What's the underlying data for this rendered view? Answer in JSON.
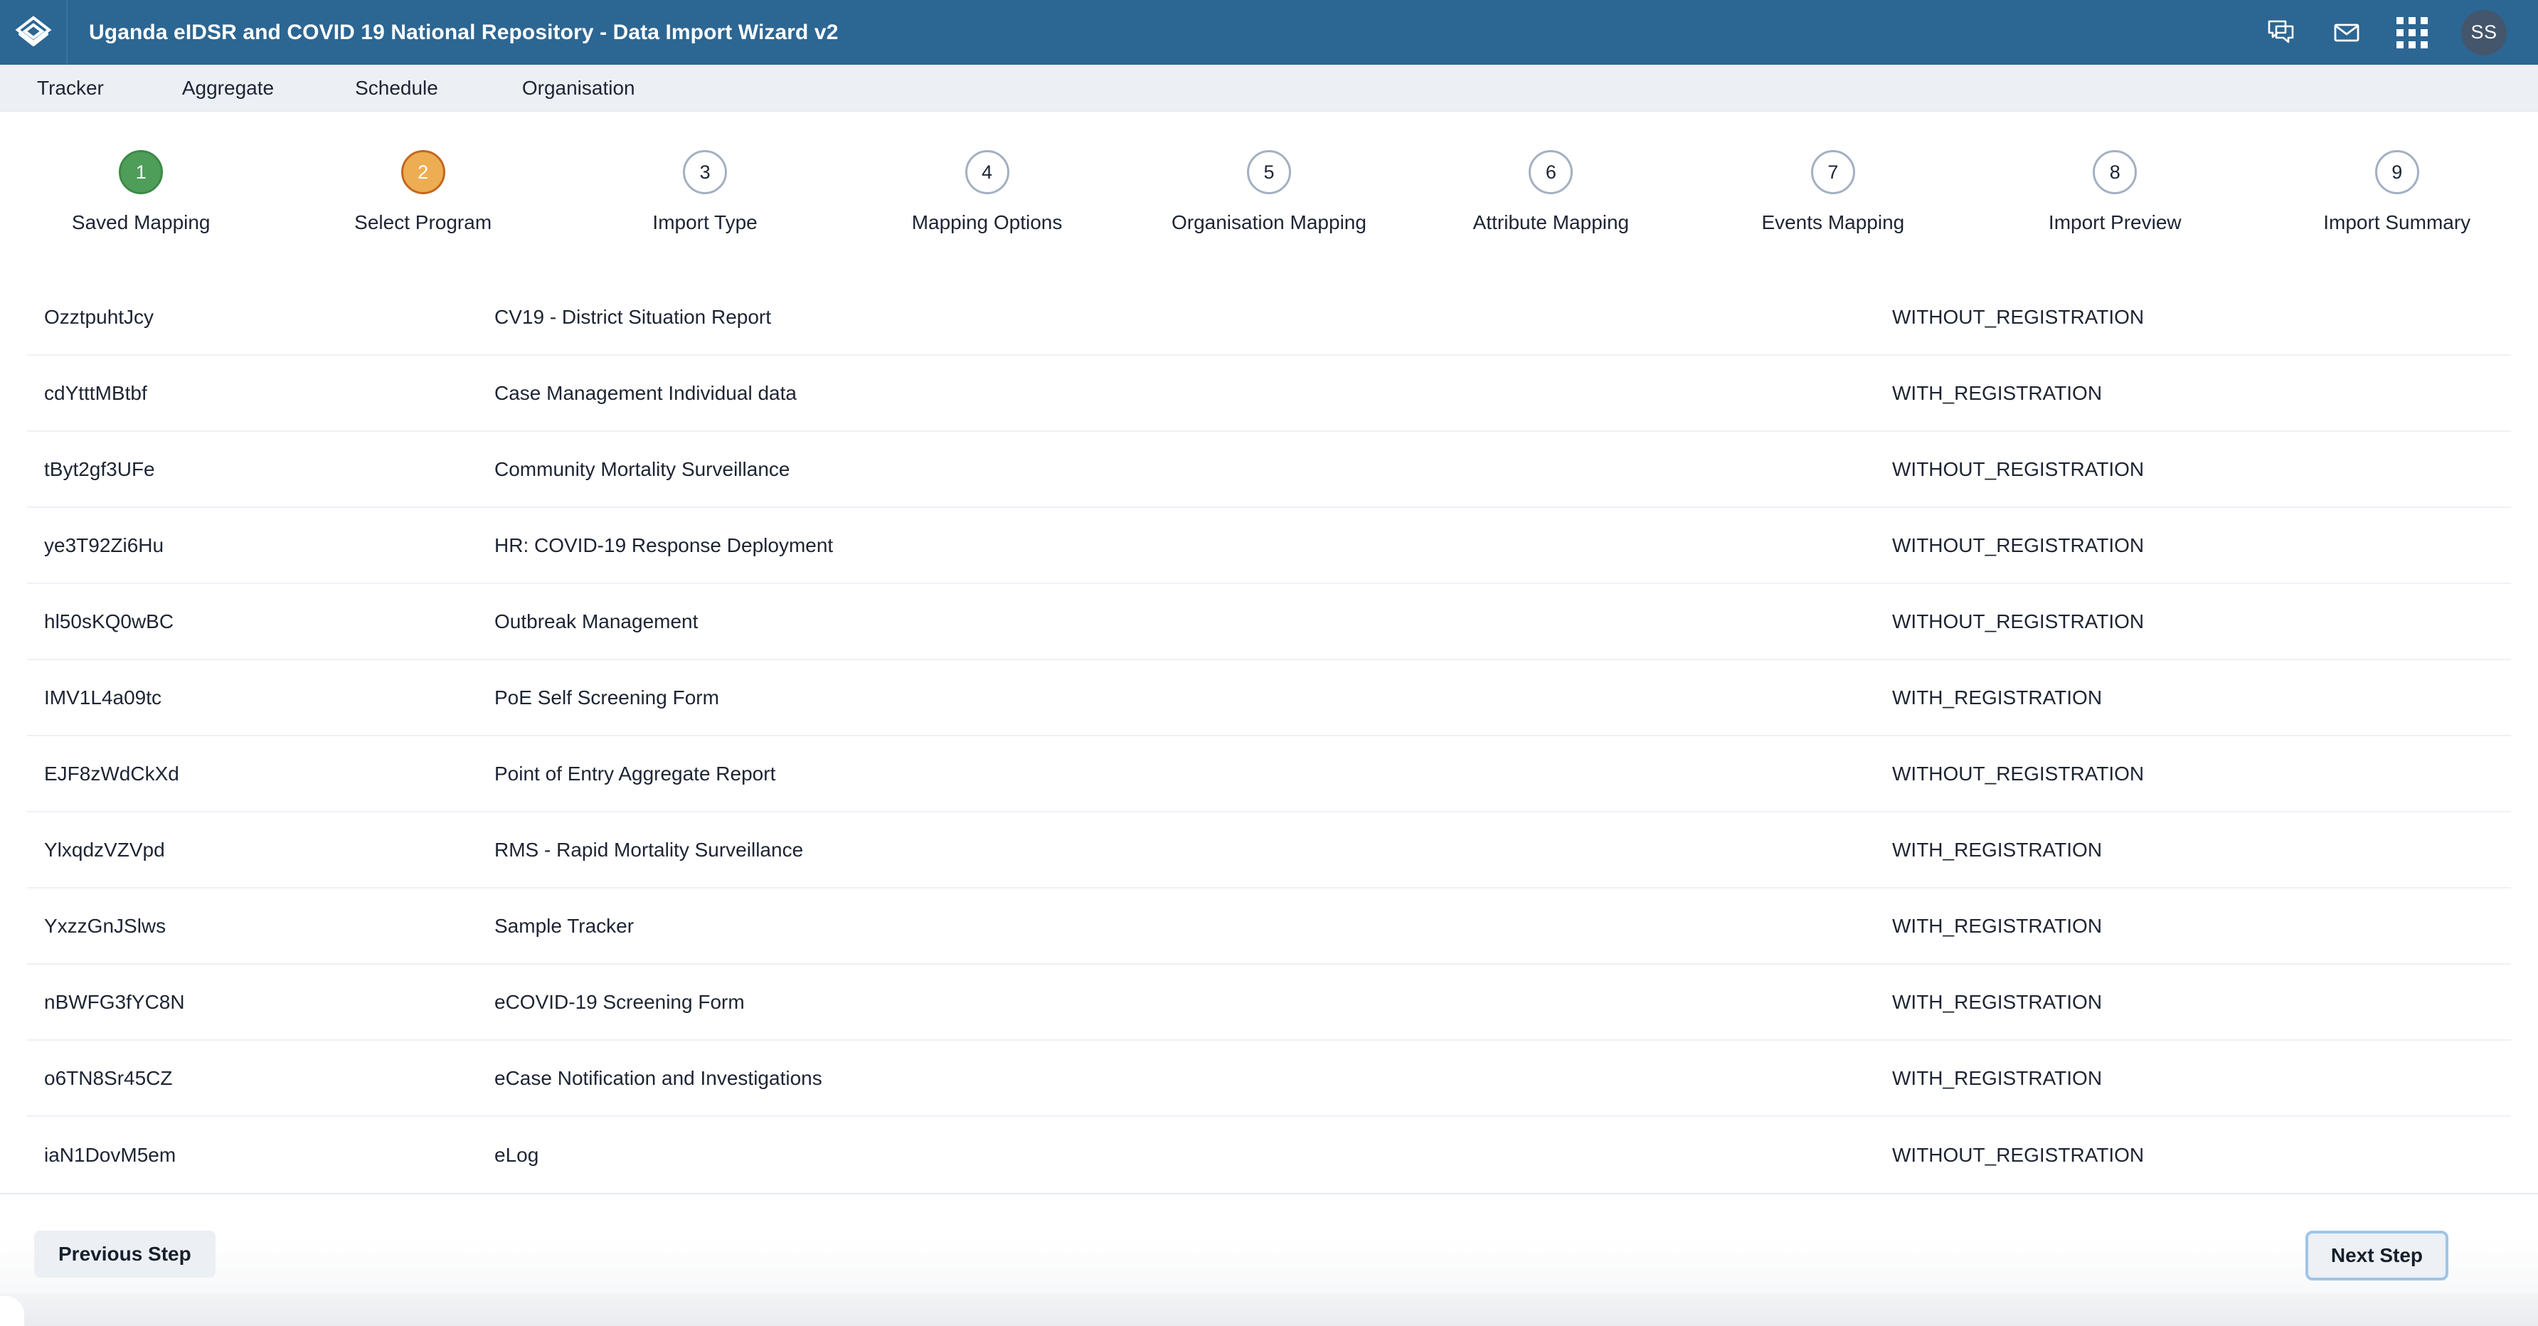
{
  "header": {
    "logo_icon": "layers-diamond-icon",
    "title": "Uganda eIDSR and COVID 19 National Repository - Data Import Wizard v2",
    "actions": [
      {
        "icon": "chat-bubbles-icon",
        "name": "messages-conversations"
      },
      {
        "icon": "envelope-icon",
        "name": "email"
      },
      {
        "icon": "apps-grid-icon",
        "name": "apps-menu"
      }
    ],
    "avatar_initials": "SS"
  },
  "nav": {
    "tabs": [
      {
        "label": "Tracker"
      },
      {
        "label": "Aggregate"
      },
      {
        "label": "Schedule"
      },
      {
        "label": "Organisation"
      }
    ]
  },
  "stepper": {
    "steps": [
      {
        "number": "1",
        "label": "Saved Mapping",
        "state": "done"
      },
      {
        "number": "2",
        "label": "Select Program",
        "state": "active"
      },
      {
        "number": "3",
        "label": "Import Type",
        "state": "pending"
      },
      {
        "number": "4",
        "label": "Mapping Options",
        "state": "pending"
      },
      {
        "number": "5",
        "label": "Organisation Mapping",
        "state": "pending"
      },
      {
        "number": "6",
        "label": "Attribute Mapping",
        "state": "pending"
      },
      {
        "number": "7",
        "label": "Events Mapping",
        "state": "pending"
      },
      {
        "number": "8",
        "label": "Import Preview",
        "state": "pending"
      },
      {
        "number": "9",
        "label": "Import Summary",
        "state": "pending"
      }
    ],
    "colors": {
      "done": "#4e9e5a",
      "active": "#edad53",
      "pending_border": "#a3b0c2"
    }
  },
  "table": {
    "rows": [
      {
        "id": "OzztpuhtJcy",
        "name": "CV19 - District Situation Report",
        "type": "WITHOUT_REGISTRATION"
      },
      {
        "id": "cdYtttMBtbf",
        "name": "Case Management Individual data",
        "type": "WITH_REGISTRATION"
      },
      {
        "id": "tByt2gf3UFe",
        "name": "Community Mortality Surveillance",
        "type": "WITHOUT_REGISTRATION"
      },
      {
        "id": "ye3T92Zi6Hu",
        "name": "HR: COVID-19 Response Deployment",
        "type": "WITHOUT_REGISTRATION"
      },
      {
        "id": "hl50sKQ0wBC",
        "name": "Outbreak Management",
        "type": "WITHOUT_REGISTRATION"
      },
      {
        "id": "IMV1L4a09tc",
        "name": "PoE Self Screening Form",
        "type": "WITH_REGISTRATION"
      },
      {
        "id": "EJF8zWdCkXd",
        "name": "Point of Entry Aggregate Report",
        "type": "WITHOUT_REGISTRATION"
      },
      {
        "id": "YlxqdzVZVpd",
        "name": "RMS - Rapid Mortality Surveillance",
        "type": "WITH_REGISTRATION"
      },
      {
        "id": "YxzzGnJSlws",
        "name": "Sample Tracker",
        "type": "WITH_REGISTRATION"
      },
      {
        "id": "nBWFG3fYC8N",
        "name": "eCOVID-19 Screening Form",
        "type": "WITH_REGISTRATION"
      },
      {
        "id": "o6TN8Sr45CZ",
        "name": "eCase Notification and Investigations",
        "type": "WITH_REGISTRATION"
      },
      {
        "id": "iaN1DovM5em",
        "name": "eLog",
        "type": "WITHOUT_REGISTRATION"
      }
    ]
  },
  "footer": {
    "previous_label": "Previous Step",
    "next_label": "Next Step",
    "next_focus_color": "#9ec5e8"
  },
  "theme": {
    "header_bg": "#2c6693",
    "nav_bg": "#eceff4",
    "text": "#1d2433",
    "row_divider": "#eef1f5"
  }
}
